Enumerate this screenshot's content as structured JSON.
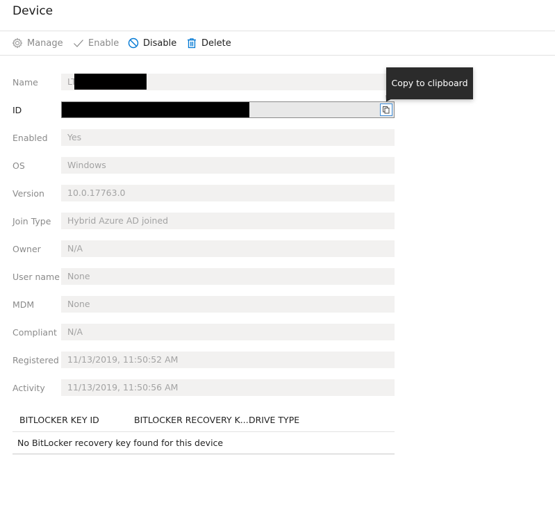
{
  "page": {
    "title": "Device"
  },
  "toolbar": {
    "manage_label": "Manage",
    "enable_label": "Enable",
    "disable_label": "Disable",
    "delete_label": "Delete"
  },
  "properties": {
    "name": {
      "label": "Name",
      "value": "LT"
    },
    "id": {
      "label": "ID",
      "value": ""
    },
    "enabled": {
      "label": "Enabled",
      "value": "Yes"
    },
    "os": {
      "label": "OS",
      "value": "Windows"
    },
    "version": {
      "label": "Version",
      "value": "10.0.17763.0"
    },
    "join_type": {
      "label": "Join Type",
      "value": "Hybrid Azure AD joined"
    },
    "owner": {
      "label": "Owner",
      "value": "N/A"
    },
    "user_name": {
      "label": "User name",
      "value": "None"
    },
    "mdm": {
      "label": "MDM",
      "value": "None"
    },
    "compliant": {
      "label": "Compliant",
      "value": "N/A"
    },
    "registered": {
      "label": "Registered",
      "value": "11/13/2019, 11:50:52 AM"
    },
    "activity": {
      "label": "Activity",
      "value": "11/13/2019, 11:50:56 AM"
    }
  },
  "tooltip": {
    "text": "Copy to clipboard"
  },
  "bitlocker": {
    "columns": [
      "BITLOCKER KEY ID",
      "BITLOCKER RECOVERY K...",
      "DRIVE TYPE"
    ],
    "empty_message": "No BitLocker recovery key found for this device"
  },
  "colors": {
    "accent": "#0078d4",
    "field_background": "#f2f1f0",
    "tooltip_background": "#2b2b2b"
  },
  "icons": {
    "manage": "gear-icon",
    "enable": "checkmark-icon",
    "disable": "block-icon",
    "delete": "trash-icon",
    "copy": "copy-icon"
  }
}
